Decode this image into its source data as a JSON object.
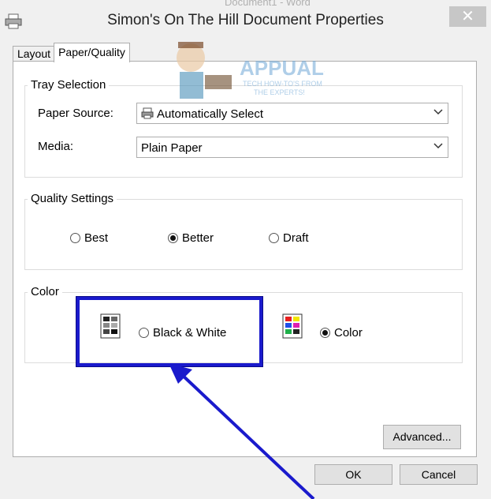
{
  "window": {
    "background_title": "Document1 - Word",
    "title": "Simon's On The Hill Document Properties",
    "close_glyph": "✕"
  },
  "tabs": [
    {
      "label": "Layout",
      "active": false
    },
    {
      "label": "Paper/Quality",
      "active": true
    }
  ],
  "tray_selection": {
    "group_label": "Tray Selection",
    "paper_source_label": "Paper Source:",
    "paper_source_value": "Automatically Select",
    "media_label": "Media:",
    "media_value": "Plain Paper"
  },
  "quality_settings": {
    "group_label": "Quality Settings",
    "options": [
      {
        "label": "Best",
        "checked": false
      },
      {
        "label": "Better",
        "checked": true
      },
      {
        "label": "Draft",
        "checked": false
      }
    ]
  },
  "color": {
    "group_label": "Color",
    "options": [
      {
        "label": "Black & White",
        "checked": false,
        "icon": "grayscale-icon"
      },
      {
        "label": "Color",
        "checked": true,
        "icon": "color-palette-icon"
      }
    ]
  },
  "buttons": {
    "advanced": "Advanced...",
    "ok": "OK",
    "cancel": "Cancel"
  },
  "watermark": {
    "brand": "APPUALS",
    "tagline_1": "TECH HOW-TO'S FROM",
    "tagline_2": "THE EXPERTS!"
  },
  "colors": {
    "highlight": "#1a1acc",
    "arrow": "#1a1acc"
  }
}
